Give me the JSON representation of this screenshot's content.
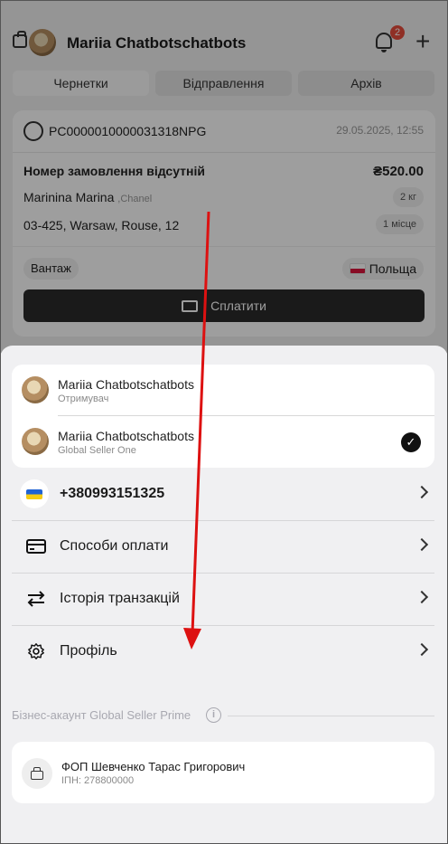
{
  "header": {
    "user_name": "Mariia Chatbotschatbots",
    "notifications": "2"
  },
  "tabs": [
    "Чернетки",
    "Відправлення",
    "Архів"
  ],
  "order": {
    "tracking": "PC0000010000031318NPG",
    "date": "29.05.2025, 12:55",
    "number_label": "Номер замовлення відсутній",
    "price": "₴520.00",
    "receiver": "Marinina Marina",
    "receiver_brand": ",Chanel",
    "weight": "2 кг",
    "address": "03-425, Warsaw, Rouse, 12",
    "places": "1 місце",
    "cargo": "Вантаж",
    "country": "Польща",
    "pay_label": "Сплатити"
  },
  "sheet": {
    "accounts": [
      {
        "name": "Mariia Chatbotschatbots",
        "role": "Отримувач"
      },
      {
        "name": "Mariia Chatbotschatbots",
        "role": "Global Seller One"
      }
    ],
    "phone": "+380993151325",
    "menu": {
      "payment_methods": "Способи оплати",
      "transactions": "Історія транзакцій",
      "profile": "Профіль"
    },
    "business_title": "Бізнес-акаунт Global Seller Prime",
    "business": {
      "name": "ФОП Шевченко Тарас Григорович",
      "tax_id": "ІПН: 278800000"
    }
  },
  "colors": {
    "arrow": "#dd1111",
    "pay_button": "#2a2a2a",
    "badge": "#e74c3c"
  }
}
